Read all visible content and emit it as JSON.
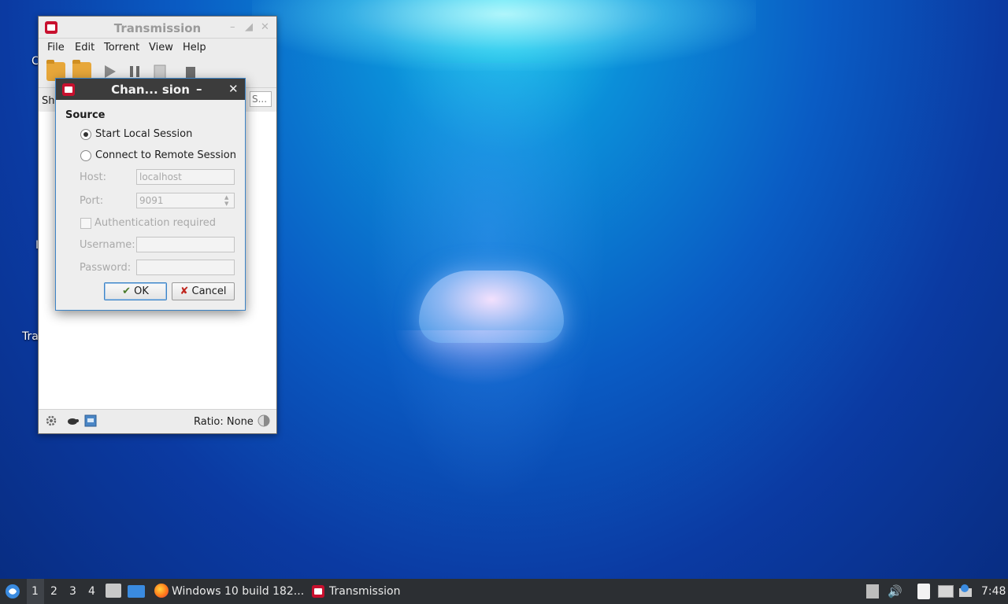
{
  "desktop": {
    "icons_partial": [
      "C",
      "I",
      "Tra"
    ]
  },
  "main_window": {
    "title": "Transmission",
    "menu": [
      "File",
      "Edit",
      "Torrent",
      "View",
      "Help"
    ],
    "filter_prefix": "Sh",
    "search_placeholder": "S...",
    "ratio_text": "Ratio: None"
  },
  "dialog": {
    "title": "Chan... sion",
    "section_label": "Source",
    "radio_local": "Start Local Session",
    "radio_remote": "Connect to Remote Session",
    "selected": "local",
    "host_label": "Host:",
    "host_value": "localhost",
    "port_label": "Port:",
    "port_value": "9091",
    "auth_label": "Authentication required",
    "username_label": "Username:",
    "password_label": "Password:",
    "ok_label": "OK",
    "cancel_label": "Cancel"
  },
  "taskbar": {
    "workspaces": [
      "1",
      "2",
      "3",
      "4"
    ],
    "active_workspace": "1",
    "tasks": [
      {
        "label": "Windows 10 build 182...",
        "icon": "firefox-icon"
      },
      {
        "label": "Transmission",
        "icon": "transmission-icon"
      }
    ],
    "clock": "7:48"
  },
  "colors": {
    "accent": "#3d84c6",
    "taskbar": "#2c2f33",
    "dialog_titlebar": "#3c3c3c"
  }
}
